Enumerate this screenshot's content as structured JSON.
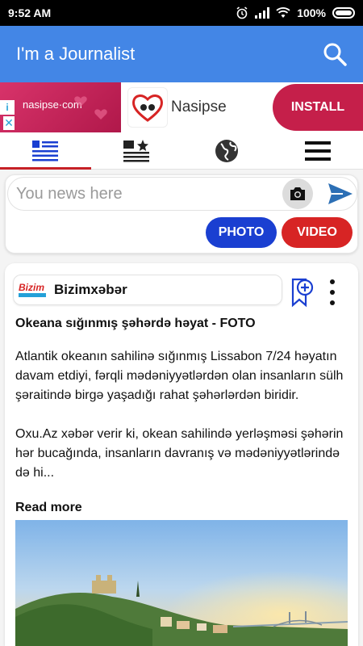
{
  "status_bar": {
    "time": "9:52 AM",
    "battery": "100%"
  },
  "app_bar": {
    "title": "I'm a Journalist",
    "search_icon": "search-icon"
  },
  "ad": {
    "brand_text": "nasipse·com",
    "name": "Nasipse",
    "install_label": "INSTALL",
    "info_label": "i",
    "close_label": "✕"
  },
  "tabs": [
    {
      "name": "news-feed",
      "icon": "list-icon",
      "active": true
    },
    {
      "name": "featured",
      "icon": "star-list-icon",
      "active": false
    },
    {
      "name": "world",
      "icon": "globe-icon",
      "active": false
    },
    {
      "name": "menu",
      "icon": "hamburger-icon",
      "active": false
    }
  ],
  "composer": {
    "placeholder": "You news here",
    "photo_label": "PHOTO",
    "video_label": "VIDEO"
  },
  "article": {
    "source_logo_text": "Bizim",
    "source_name": "Bizimxəbər",
    "headline": "Okeana sığınmış şəhərdə həyat - FOTO",
    "paragraph1": "Atlantik okeanın sahilinə sığınmış Lissabon 7/24 həyatın davam etdiyi, fərqli mədəniyyətlərdən olan insanların sülh şəraitində birgə yaşadığı rahat şəhərlərdən biridir.",
    "paragraph2": "Oxu.Az xəbər verir ki, okean sahilində yerləşməsi şəhərin hər bucağında, insanların davranış və mədəniyyətlərində də hi...",
    "read_more": "Read more"
  },
  "colors": {
    "app_bar": "#4386e6",
    "photo_button": "#1a3fd1",
    "video_button": "#d72424",
    "tab_indicator": "#c62026"
  }
}
